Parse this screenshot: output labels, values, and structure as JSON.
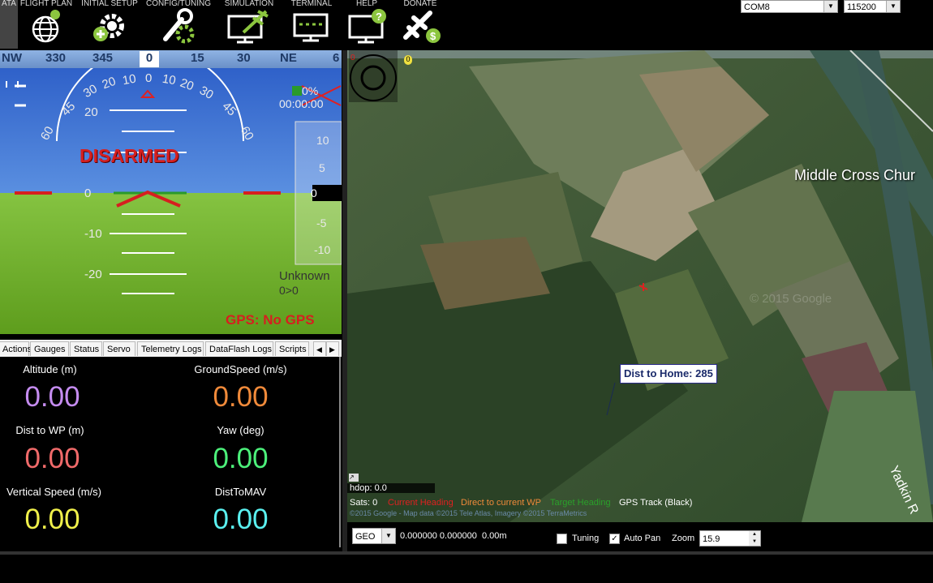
{
  "toolbar": {
    "items": [
      {
        "label": "ATA",
        "icon": "data-icon"
      },
      {
        "label": "FLIGHT PLAN",
        "icon": "globe-icon"
      },
      {
        "label": "INITIAL SETUP",
        "icon": "gear-plus-icon"
      },
      {
        "label": "CONFIG/TUNING",
        "icon": "wrench-gear-icon"
      },
      {
        "label": "SIMULATION",
        "icon": "monitor-plane-icon"
      },
      {
        "label": "TERMINAL",
        "icon": "terminal-icon"
      },
      {
        "label": "HELP",
        "icon": "monitor-help-icon"
      },
      {
        "label": "DONATE",
        "icon": "plane-dollar-icon"
      }
    ],
    "port": "COM8",
    "baud": "115200"
  },
  "hud": {
    "compass": [
      "NW",
      "330",
      "345",
      "0",
      "15",
      "30",
      "NE",
      "6"
    ],
    "roll_scale": [
      "60",
      "45",
      "30",
      "20",
      "10",
      "0",
      "10",
      "20",
      "30",
      "45",
      "60"
    ],
    "pitch": {
      "p20": "20",
      "p0": "0",
      "m10": "-10",
      "m20": "-20"
    },
    "status": "DISARMED",
    "battery": "0%",
    "time": "00:00:00",
    "vsi": {
      "t10": "10",
      "t5": "5",
      "t0": "0",
      "m5": "-5",
      "m10": "-10"
    },
    "mode": "Unknown",
    "wp": "0>0",
    "gps": "GPS: No GPS",
    "colors": {
      "sky": "#3b6fd6",
      "ground": "#72b12e",
      "status": "#d61f1f"
    }
  },
  "tabs": [
    "Actions",
    "Gauges",
    "Status",
    "Servo",
    "Telemetry Logs",
    "DataFlash Logs",
    "Scripts"
  ],
  "quick": [
    {
      "label": "Altitude (m)",
      "value": "0.00",
      "color": "#c58cf0"
    },
    {
      "label": "GroundSpeed (m/s)",
      "value": "0.00",
      "color": "#f08a3a"
    },
    {
      "label": "Dist to WP (m)",
      "value": "0.00",
      "color": "#f06a6a"
    },
    {
      "label": "Yaw (deg)",
      "value": "0.00",
      "color": "#4cf07a"
    },
    {
      "label": "Vertical Speed (m/s)",
      "value": "0.00",
      "color": "#f0f04a"
    },
    {
      "label": "DistToMAV",
      "value": "0.00",
      "color": "#5af0f0"
    }
  ],
  "map": {
    "place_label": "Middle Cross Chur",
    "river_label": "Yadkin R",
    "watermark": "© 2015 Google",
    "dist_home": "Dist to Home: 285",
    "hdop": "hdop: 0.0",
    "sats": "Sats: 0",
    "legend": [
      {
        "text": "Current Heading",
        "color": "#e02020"
      },
      {
        "text": "Direct to current WP",
        "color": "#f08a3a"
      },
      {
        "text": "Target Heading",
        "color": "#2aa02a"
      },
      {
        "text": "GPS Track (Black)",
        "color": "#ffffff"
      }
    ],
    "copyright": "©2015 Google - Map data ©2015 Tele Atlas, Imagery ©2015 TerraMetrics",
    "corner_red": "0",
    "corner_yellow": "0"
  },
  "mapbar": {
    "coord_type": "GEO",
    "coords": "0.000000 0.000000",
    "alt": "0.00m",
    "tuning": "Tuning",
    "tuning_checked": false,
    "autopan": "Auto Pan",
    "autopan_checked": true,
    "zoom_label": "Zoom",
    "zoom": "15.9"
  }
}
